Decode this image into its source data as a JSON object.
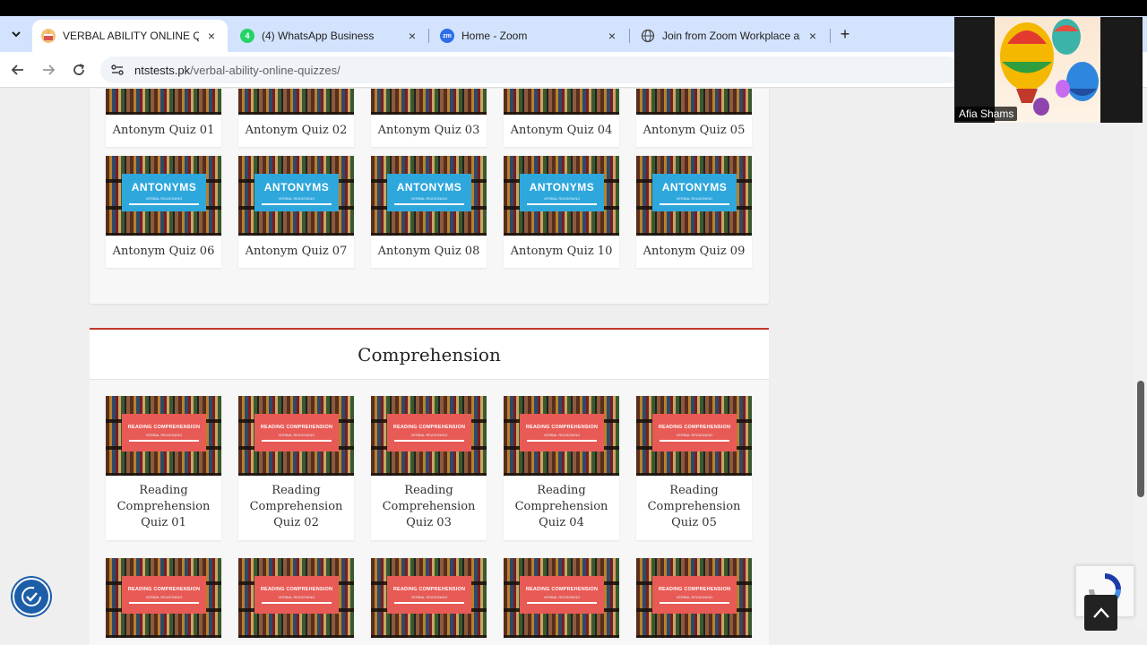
{
  "browser": {
    "tabs": [
      {
        "title": "VERBAL ABILITY ONLINE QUIZZ",
        "active": true,
        "favicon": "cake-favicon-icon",
        "close": "×"
      },
      {
        "title": "(4) WhatsApp Business",
        "active": false,
        "favicon": "whatsapp-business-icon",
        "badge": "4",
        "close": "×"
      },
      {
        "title": "Home - Zoom",
        "active": false,
        "favicon": "zoom-icon",
        "badge": "zm",
        "close": "×"
      },
      {
        "title": "Join from Zoom Workplace app",
        "active": false,
        "favicon": "globe-icon",
        "close": "×"
      }
    ],
    "new_tab": "+",
    "url_host": "ntstests.pk",
    "url_path": "/verbal-ability-online-quizzes/"
  },
  "antonyms": {
    "banner_title": "ANTONYMS",
    "banner_sub": "VERBAL REASONING",
    "row1": [
      "Antonym Quiz 01",
      "Antonym Quiz 02",
      "Antonym Quiz 03",
      "Antonym Quiz 04",
      "Antonym Quiz 05"
    ],
    "row2": [
      "Antonym Quiz 06",
      "Antonym Quiz 07",
      "Antonym Quiz 08",
      "Antonym Quiz 10",
      "Antonym Quiz 09"
    ]
  },
  "comprehension": {
    "heading": "Comprehension",
    "banner_title": "READING COMPREHENSION",
    "banner_sub": "VERBAL REASONING",
    "row1": [
      [
        "Reading",
        "Comprehension",
        "Quiz 01"
      ],
      [
        "Reading",
        "Comprehension",
        "Quiz 02"
      ],
      [
        "Reading",
        "Comprehension",
        "Quiz 03"
      ],
      [
        "Reading",
        "Comprehension",
        "Quiz 04"
      ],
      [
        "Reading",
        "Comprehension",
        "Quiz 05"
      ]
    ]
  },
  "zoom": {
    "participant_name": "Afia Shams"
  },
  "colors": {
    "antonym_banner": "#2ea7dd",
    "comprehension_banner": "#e85a55",
    "section_accent": "#c0392b",
    "tabstrip": "#d3e3fd"
  }
}
